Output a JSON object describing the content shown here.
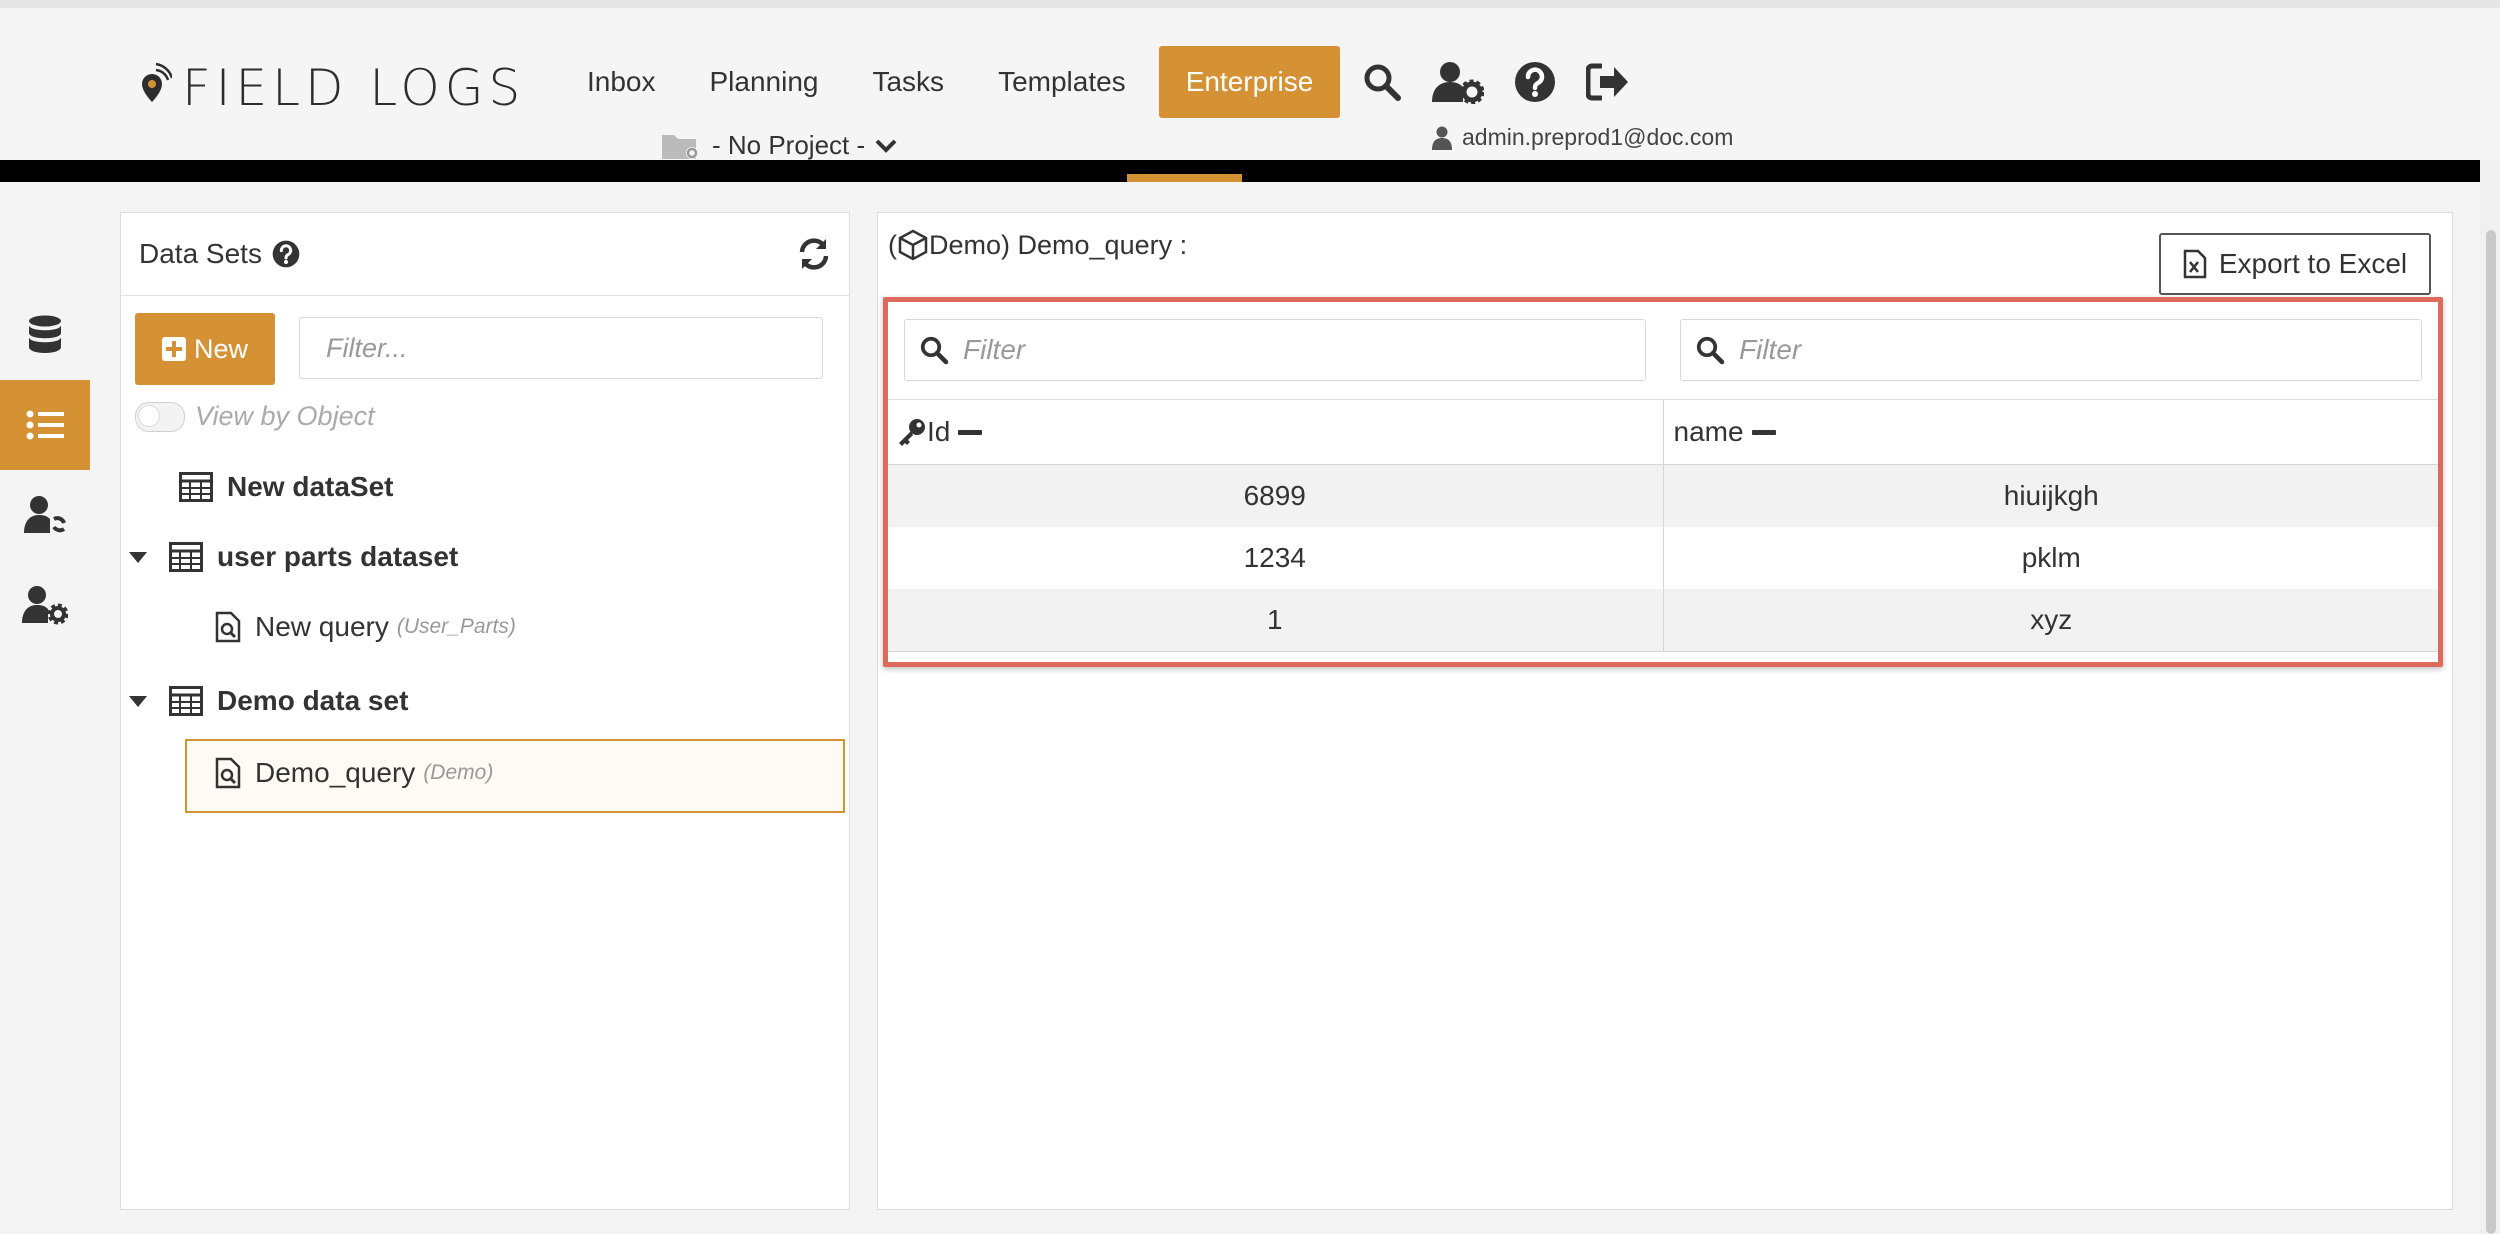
{
  "app": {
    "logo_text": "FIELD LOGS"
  },
  "nav": {
    "items": [
      "Inbox",
      "Planning",
      "Tasks",
      "Templates",
      "Enterprise"
    ],
    "active": "Enterprise"
  },
  "project": {
    "label": "- No Project -"
  },
  "user": {
    "email": "admin.preprod1@doc.com"
  },
  "colors": {
    "accent": "#d49234",
    "highlight": "#de6a5c"
  },
  "left_panel": {
    "title": "Data Sets",
    "new_label": "New",
    "filter_placeholder": "Filter...",
    "toggle_label": "View by Object",
    "tree": {
      "n1": {
        "label": "New dataSet"
      },
      "n2": {
        "label": "user parts dataset"
      },
      "n2c": {
        "label": "New query",
        "sub": "(User_Parts)"
      },
      "n3": {
        "label": "Demo data set"
      },
      "n3c": {
        "label": "Demo_query",
        "sub": "(Demo)"
      }
    }
  },
  "right_panel": {
    "title_prefix": "(",
    "title": "Demo) Demo_query :",
    "export_label": "Export to Excel",
    "filter_placeholder": "Filter",
    "columns": [
      "Id",
      "name"
    ],
    "rows": [
      [
        "6899",
        "hiuijkgh"
      ],
      [
        "1234",
        "pklm"
      ],
      [
        "1",
        "xyz"
      ]
    ]
  }
}
